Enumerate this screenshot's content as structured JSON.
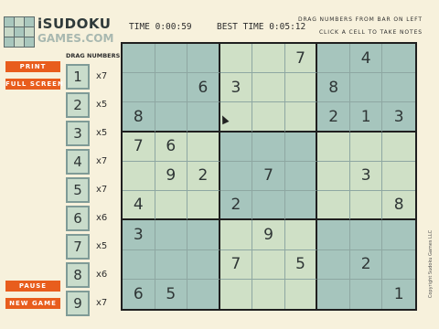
{
  "logo": {
    "line1": "iSUDOKU",
    "line2": "GAMES.COM"
  },
  "timer": "TIME 0:00:59",
  "best_time": "BEST TIME 0:05:12",
  "instructions": [
    "DRAG NUMBERS FROM BAR ON LEFT",
    "CLICK A CELL TO TAKE NOTES"
  ],
  "buttons": {
    "print": "PRINT",
    "full_screen": "FULL SCREEN",
    "pause": "PAUSE",
    "new_game": "NEW GAME"
  },
  "tray": {
    "title": "DRAG NUMBERS",
    "items": [
      {
        "number": "1",
        "count": "x7"
      },
      {
        "number": "2",
        "count": "x5"
      },
      {
        "number": "3",
        "count": "x5"
      },
      {
        "number": "4",
        "count": "x7"
      },
      {
        "number": "5",
        "count": "x7"
      },
      {
        "number": "6",
        "count": "x6"
      },
      {
        "number": "7",
        "count": "x5"
      },
      {
        "number": "8",
        "count": "x6"
      },
      {
        "number": "9",
        "count": "x7"
      }
    ]
  },
  "board": [
    [
      "",
      "",
      "",
      "",
      "",
      "7",
      "",
      "4",
      ""
    ],
    [
      "",
      "",
      "6",
      "3",
      "",
      "",
      "8",
      "",
      ""
    ],
    [
      "8",
      "",
      "",
      "",
      "",
      "",
      "2",
      "1",
      "3"
    ],
    [
      "7",
      "6",
      "",
      "",
      "",
      "",
      "",
      "",
      ""
    ],
    [
      "",
      "9",
      "2",
      "",
      "7",
      "",
      "",
      "3",
      ""
    ],
    [
      "4",
      "",
      "",
      "2",
      "",
      "",
      "",
      "",
      "8"
    ],
    [
      "3",
      "",
      "",
      "",
      "9",
      "",
      "",
      "",
      ""
    ],
    [
      "",
      "",
      "",
      "7",
      "",
      "5",
      "",
      "2",
      ""
    ],
    [
      "6",
      "5",
      "",
      "",
      "",
      "",
      "",
      "",
      "1"
    ]
  ],
  "copyright": "Copyright Sudoku Games LLC",
  "colors": {
    "accent": "#e85d1d",
    "cell_dark": "#a6c5bd",
    "cell_light": "#cfe0c6",
    "background": "#f7f1dc"
  }
}
